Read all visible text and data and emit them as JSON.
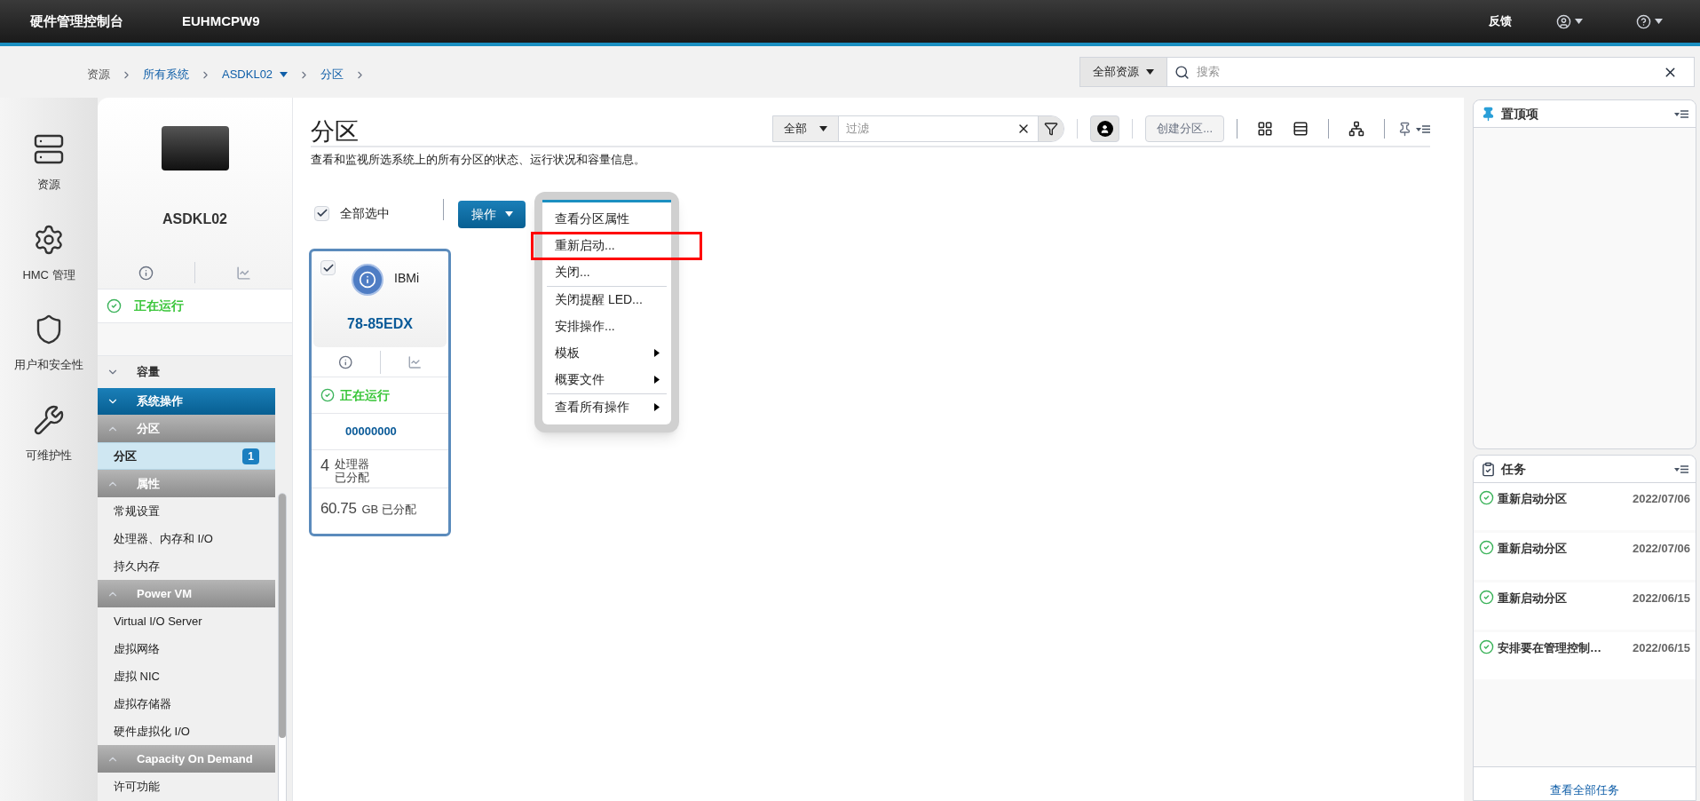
{
  "header": {
    "title": "硬件管理控制台",
    "system": "EUHMCPW9",
    "feedback": "反馈"
  },
  "breadcrumb": [
    {
      "label": "资源",
      "kind": "plain"
    },
    {
      "label": "所有系统",
      "kind": "link"
    },
    {
      "label": "ASDKL02",
      "kind": "menu"
    },
    {
      "label": "分区",
      "kind": "link"
    }
  ],
  "search": {
    "scope": "全部资源",
    "placeholder": "搜索"
  },
  "nav_rail": [
    {
      "label": "资源",
      "kind": "server"
    },
    {
      "label": "HMC 管理",
      "kind": "gear"
    },
    {
      "label": "用户和安全性",
      "kind": "shield"
    },
    {
      "label": "可维护性",
      "kind": "wrench"
    }
  ],
  "system": {
    "name": "ASDKL02",
    "status": "正在运行"
  },
  "sidebar": [
    {
      "kind": "collapsible",
      "label": "容量",
      "expanded": false
    },
    {
      "kind": "section",
      "label": "系统操作",
      "expanded": true
    },
    {
      "kind": "group",
      "label": "分区",
      "expanded": true,
      "items": [
        {
          "label": "分区",
          "count": "1",
          "selected": true
        }
      ]
    },
    {
      "kind": "group",
      "label": "属性",
      "expanded": true,
      "items": [
        {
          "label": "常规设置",
          "selected": false
        },
        {
          "label": "处理器、内存和 I/O",
          "selected": false
        },
        {
          "label": "持久内存",
          "selected": false
        }
      ]
    },
    {
      "kind": "group",
      "label": "Power VM",
      "expanded": true,
      "items": [
        {
          "label": "Virtual I/O Server",
          "selected": false
        },
        {
          "label": "虚拟网络",
          "selected": false
        },
        {
          "label": "虚拟 NIC",
          "selected": false
        },
        {
          "label": "虚拟存储器",
          "selected": false
        },
        {
          "label": "硬件虚拟化 I/O",
          "selected": false
        }
      ]
    },
    {
      "kind": "group",
      "label": "Capacity On Demand",
      "expanded": true,
      "items": [
        {
          "label": "许可功能",
          "selected": false
        }
      ]
    }
  ],
  "page": {
    "title": "分区",
    "description": "查看和监视所选系统上的所有分区的状态、运行状况和容量信息。",
    "filter": {
      "scope": "全部",
      "placeholder": "过滤"
    },
    "create_button": "创建分区...",
    "select_all": {
      "label": "全部选中",
      "checked": true
    },
    "actions_button": "操作"
  },
  "menu": [
    [
      {
        "label": "查看分区属性",
        "submenu": false,
        "highlighted": false
      },
      {
        "label": "重新启动...",
        "submenu": false,
        "highlighted": true
      },
      {
        "label": "关闭...",
        "submenu": false,
        "highlighted": false
      }
    ],
    [
      {
        "label": "关闭提醒 LED...",
        "submenu": false,
        "highlighted": false
      },
      {
        "label": "安排操作...",
        "submenu": false,
        "highlighted": false
      },
      {
        "label": "模板",
        "submenu": true,
        "highlighted": false
      },
      {
        "label": "概要文件",
        "submenu": true,
        "highlighted": false
      }
    ],
    [
      {
        "label": "查看所有操作",
        "submenu": true,
        "highlighted": false
      }
    ]
  ],
  "partitions": [
    {
      "checked": true,
      "os": "IBMi",
      "name": "78-85EDX",
      "status": "正在运行",
      "id": "00000000",
      "processors": "4",
      "processors_label": "处理器",
      "processors_sub": "已分配",
      "memory": "60.75",
      "memory_unit": "GB 已分配"
    }
  ],
  "pinned": {
    "title": "置顶项"
  },
  "tasks": {
    "title": "任务",
    "items": [
      {
        "name": "重新启动分区",
        "date": "2022/07/06"
      },
      {
        "name": "重新启动分区",
        "date": "2022/07/06"
      },
      {
        "name": "重新启动分区",
        "date": "2022/06/15"
      },
      {
        "name": "安排要在管理控制…",
        "date": "2022/06/15"
      }
    ],
    "view_all": "查看全部任务"
  }
}
